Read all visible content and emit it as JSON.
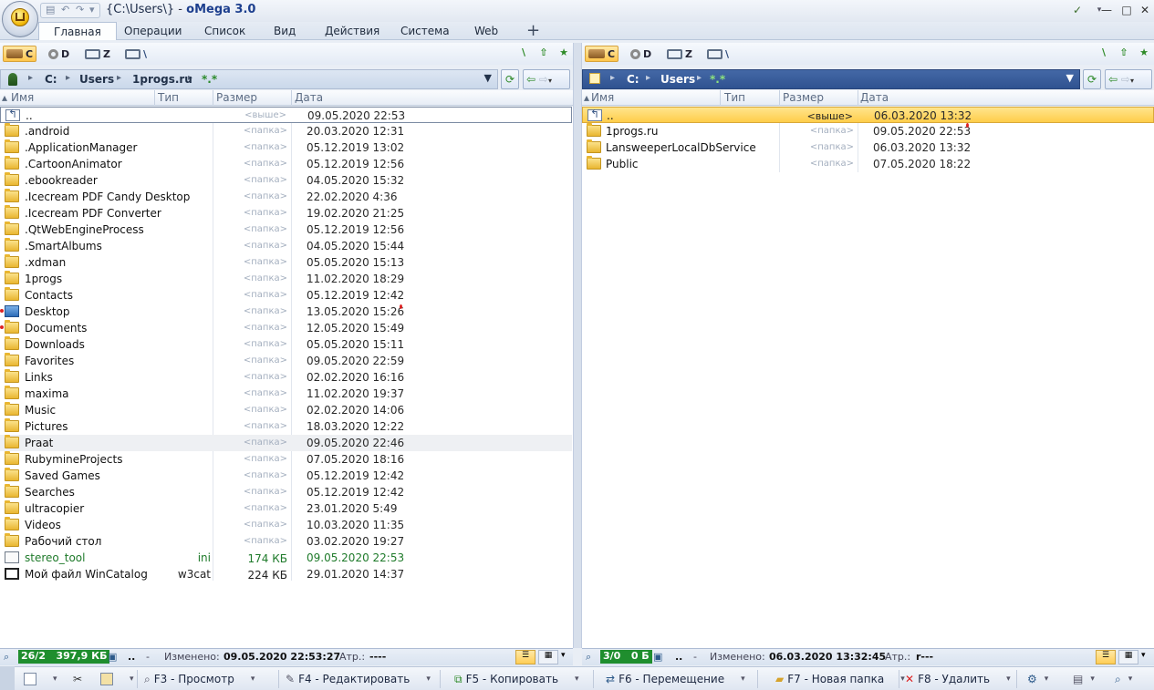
{
  "window": {
    "title_path": "{C:\\Users\\}",
    "title_sep": " - ",
    "title_app": "oMega 3.0",
    "minimize": "—",
    "maximize": "□",
    "close": "✕",
    "help": "✓"
  },
  "menu": {
    "items": [
      "Главная",
      "Операции",
      "Список",
      "Вид",
      "Действия",
      "Система",
      "Web"
    ],
    "add": "+"
  },
  "left_panel": {
    "drives": [
      "C",
      "D",
      "Z"
    ],
    "path": [
      "C:",
      "Users",
      "1progs.ru",
      "*.*"
    ],
    "columns": [
      "Имя",
      "Тип",
      "Размер",
      "Дата"
    ],
    "rows": [
      {
        "name": "..",
        "type": "",
        "size": "<выше>",
        "date": "09.05.2020 22:53",
        "icon": "up-icon"
      },
      {
        "name": ".android",
        "type": "",
        "size": "<папка>",
        "date": "20.03.2020 12:31",
        "icon": "folder-icon"
      },
      {
        "name": ".ApplicationManager",
        "type": "",
        "size": "<папка>",
        "date": "05.12.2019 13:02",
        "icon": "folder-icon"
      },
      {
        "name": ".CartoonAnimator",
        "type": "",
        "size": "<папка>",
        "date": "05.12.2019 12:56",
        "icon": "folder-icon"
      },
      {
        "name": ".ebookreader",
        "type": "",
        "size": "<папка>",
        "date": "04.05.2020 15:32",
        "icon": "folder-icon"
      },
      {
        "name": ".Icecream PDF Candy Desktop",
        "type": "",
        "size": "<папка>",
        "date": "22.02.2020 4:36",
        "icon": "folder-icon"
      },
      {
        "name": ".Icecream PDF Converter",
        "type": "",
        "size": "<папка>",
        "date": "19.02.2020 21:25",
        "icon": "folder-icon"
      },
      {
        "name": ".QtWebEngineProcess",
        "type": "",
        "size": "<папка>",
        "date": "05.12.2019 12:56",
        "icon": "folder-icon"
      },
      {
        "name": ".SmartAlbums",
        "type": "",
        "size": "<папка>",
        "date": "04.05.2020 15:44",
        "icon": "folder-icon"
      },
      {
        "name": ".xdman",
        "type": "",
        "size": "<папка>",
        "date": "05.05.2020 15:13",
        "icon": "folder-icon"
      },
      {
        "name": "1progs",
        "type": "",
        "size": "<папка>",
        "date": "11.02.2020 18:29",
        "icon": "folder-icon"
      },
      {
        "name": "Contacts",
        "type": "",
        "size": "<папка>",
        "date": "05.12.2019 12:42",
        "icon": "folder-icon"
      },
      {
        "name": "Desktop",
        "type": "",
        "size": "<папка>",
        "date": "13.05.2020 15:26",
        "icon": "desktop-icon"
      },
      {
        "name": "Documents",
        "type": "",
        "size": "<папка>",
        "date": "12.05.2020 15:49",
        "icon": "folder-icon"
      },
      {
        "name": "Downloads",
        "type": "",
        "size": "<папка>",
        "date": "05.05.2020 15:11",
        "icon": "folder-icon"
      },
      {
        "name": "Favorites",
        "type": "",
        "size": "<папка>",
        "date": "09.05.2020 22:59",
        "icon": "folder-icon"
      },
      {
        "name": "Links",
        "type": "",
        "size": "<папка>",
        "date": "02.02.2020 16:16",
        "icon": "folder-icon"
      },
      {
        "name": "maxima",
        "type": "",
        "size": "<папка>",
        "date": "11.02.2020 19:37",
        "icon": "folder-icon"
      },
      {
        "name": "Music",
        "type": "",
        "size": "<папка>",
        "date": "02.02.2020 14:06",
        "icon": "folder-icon"
      },
      {
        "name": "Pictures",
        "type": "",
        "size": "<папка>",
        "date": "18.03.2020 12:22",
        "icon": "folder-icon"
      },
      {
        "name": "Praat",
        "type": "",
        "size": "<папка>",
        "date": "09.05.2020 22:46",
        "icon": "folder-icon"
      },
      {
        "name": "RubymineProjects",
        "type": "",
        "size": "<папка>",
        "date": "07.05.2020 18:16",
        "icon": "folder-icon"
      },
      {
        "name": "Saved Games",
        "type": "",
        "size": "<папка>",
        "date": "05.12.2019 12:42",
        "icon": "folder-icon"
      },
      {
        "name": "Searches",
        "type": "",
        "size": "<папка>",
        "date": "05.12.2019 12:42",
        "icon": "folder-icon"
      },
      {
        "name": "ultracopier",
        "type": "",
        "size": "<папка>",
        "date": "23.01.2020 5:49",
        "icon": "folder-icon"
      },
      {
        "name": "Videos",
        "type": "",
        "size": "<папка>",
        "date": "10.03.2020 11:35",
        "icon": "folder-icon"
      },
      {
        "name": "Рабочий стол",
        "type": "",
        "size": "<папка>",
        "date": "03.02.2020 19:27",
        "icon": "folder-icon"
      },
      {
        "name": "stereo_tool",
        "type": "ini",
        "size": "174 КБ",
        "date": "09.05.2020 22:53",
        "icon": "ini-file-icon"
      },
      {
        "name": "Мой файл WinCatalog",
        "type": "w3cat",
        "size": "224 КБ",
        "date": "29.01.2020 14:37",
        "icon": "wincatalog-file-icon"
      }
    ],
    "status": {
      "count": "26/2",
      "size": "397,9 КБ",
      "dots": "..",
      "dash": "-",
      "changed_label": "Изменено:",
      "changed_value": "09.05.2020 22:53:27",
      "attr_label": "Атр.:",
      "attr_value": "----"
    }
  },
  "right_panel": {
    "drives": [
      "C",
      "D",
      "Z"
    ],
    "path": [
      "C:",
      "Users",
      "*.*"
    ],
    "columns": [
      "Имя",
      "Тип",
      "Размер",
      "Дата"
    ],
    "rows": [
      {
        "name": "..",
        "type": "",
        "size": "<выше>",
        "date": "06.03.2020 13:32",
        "icon": "up-icon"
      },
      {
        "name": "1progs.ru",
        "type": "",
        "size": "<папка>",
        "date": "09.05.2020 22:53",
        "icon": "folder-icon"
      },
      {
        "name": "LansweeperLocalDbService",
        "type": "",
        "size": "<папка>",
        "date": "06.03.2020 13:32",
        "icon": "folder-icon"
      },
      {
        "name": "Public",
        "type": "",
        "size": "<папка>",
        "date": "07.05.2020 18:22",
        "icon": "folder-icon"
      }
    ],
    "status": {
      "count": "3/0",
      "size": "0 Б",
      "dots": "..",
      "dash": "-",
      "changed_label": "Изменено:",
      "changed_value": "06.03.2020 13:32:45",
      "attr_label": "Атр.:",
      "attr_value": "r---"
    }
  },
  "fkeys": [
    {
      "label": "F3 - Просмотр",
      "icon": "view-icon"
    },
    {
      "label": "F4 - Редактировать",
      "icon": "edit-icon"
    },
    {
      "label": "F5 - Копировать",
      "icon": "copy-icon"
    },
    {
      "label": "F6 - Перемещение",
      "icon": "move-icon"
    },
    {
      "label": "F7 - Новая папка",
      "icon": "new-folder-icon"
    },
    {
      "label": "F8 - Удалить",
      "icon": "delete-icon"
    }
  ],
  "colors": {
    "accent_active": "#ffcd4a",
    "right_path_bg": "#2f5290",
    "file_green": "#1e7a2a"
  }
}
